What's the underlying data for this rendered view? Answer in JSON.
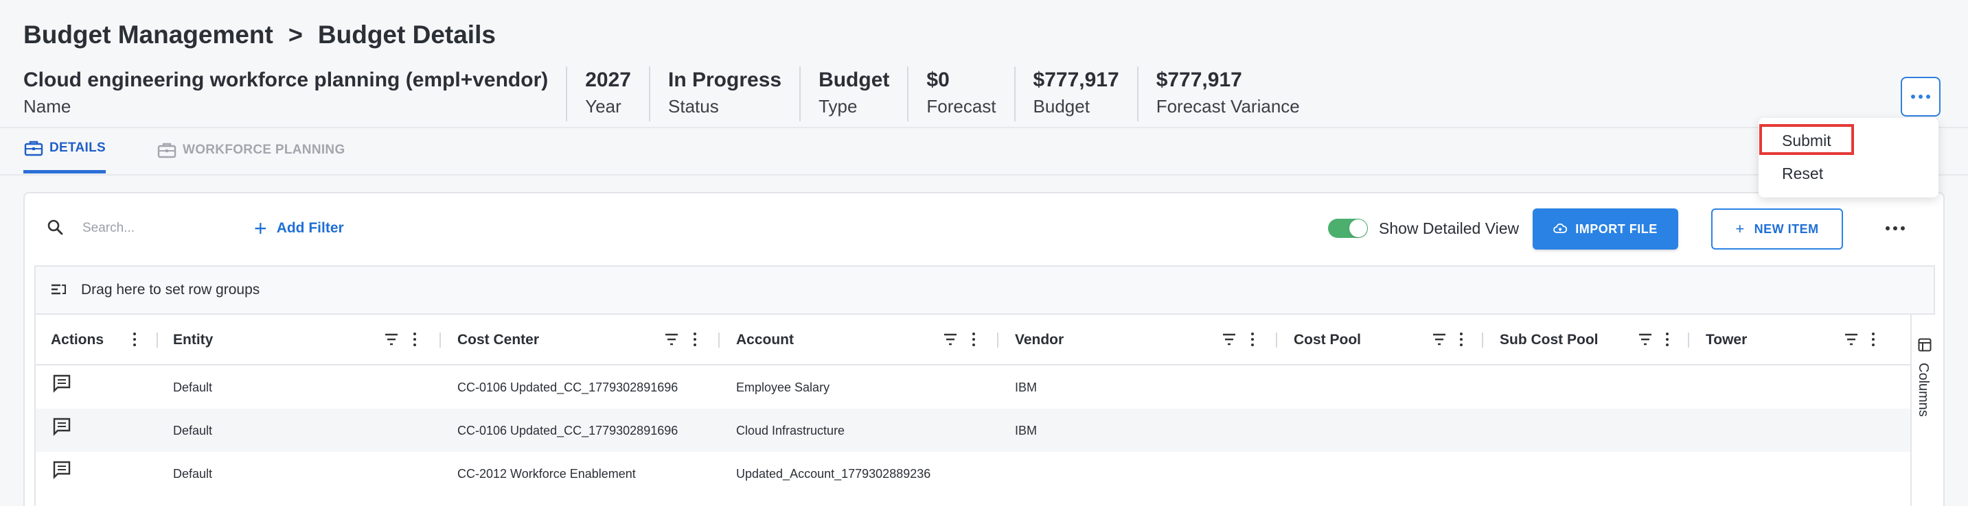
{
  "breadcrumb": {
    "parent": "Budget Management",
    "separator": ">",
    "current": "Budget Details"
  },
  "summary": [
    {
      "value": "Cloud engineering workforce planning (empl+vendor)",
      "label": "Name"
    },
    {
      "value": "2027",
      "label": "Year"
    },
    {
      "value": "In Progress",
      "label": "Status"
    },
    {
      "value": "Budget",
      "label": "Type"
    },
    {
      "value": "$0",
      "label": "Forecast"
    },
    {
      "value": "$777,917",
      "label": "Budget"
    },
    {
      "value": "$777,917",
      "label": "Forecast Variance"
    }
  ],
  "tabs": [
    {
      "label": "DETAILS",
      "active": true,
      "icon": "briefcase-icon"
    },
    {
      "label": "WORKFORCE PLANNING",
      "active": false,
      "icon": "briefcase-icon"
    }
  ],
  "dropdown": {
    "items": [
      "Submit",
      "Reset"
    ],
    "highlighted": "Submit",
    "highlight_color": "#e53935"
  },
  "toolbar": {
    "search_placeholder": "Search...",
    "add_filter_label": "Add Filter",
    "toggle_label": "Show Detailed View",
    "toggle_on": true,
    "import_label": "IMPORT FILE",
    "new_item_label": "NEW ITEM"
  },
  "grid": {
    "group_bar_label": "Drag here to set row groups",
    "columns": [
      "Actions",
      "Entity",
      "Cost Center",
      "Account",
      "Vendor",
      "Cost Pool",
      "Sub Cost Pool",
      "Tower"
    ],
    "rows": [
      [
        "Default",
        "CC-0106 Updated_CC_1779302891696",
        "Employee Salary",
        "IBM",
        "",
        "",
        ""
      ],
      [
        "Default",
        "CC-0106 Updated_CC_1779302891696",
        "Cloud Infrastructure",
        "IBM",
        "",
        "",
        ""
      ],
      [
        "Default",
        "CC-2012 Workforce Enablement",
        "Updated_Account_1779302889236",
        "",
        "",
        "",
        ""
      ]
    ],
    "side_panel_label": "Columns"
  },
  "colors": {
    "accent": "#2a82e4",
    "active_tab": "#1f5ec7",
    "toggle_on": "#4caf6e"
  }
}
